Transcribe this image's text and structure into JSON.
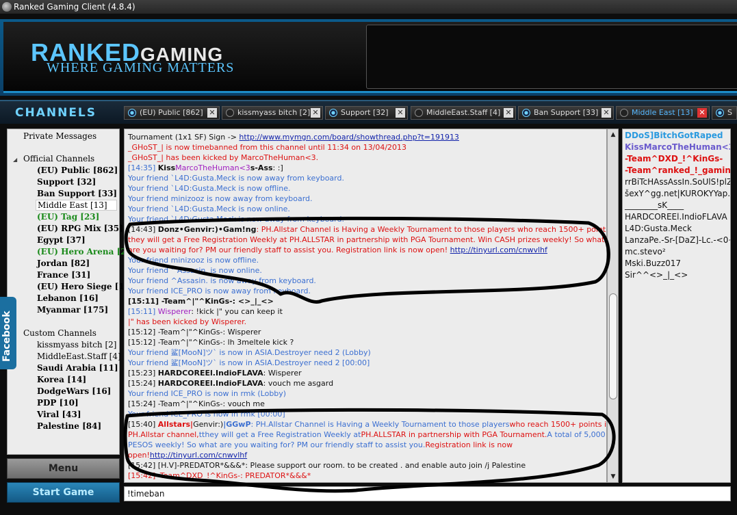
{
  "window": {
    "title": "Ranked Gaming Client (4.8.4)"
  },
  "banner": {
    "logo_main": "RANKED",
    "logo_main2": "GAMING",
    "logo_sub": "WHERE GAMING MATTERS"
  },
  "channels_label": "CHANNELS",
  "tabs": [
    {
      "label": "(EU) Public [862]"
    },
    {
      "label": "kissmyass bitch [2]"
    },
    {
      "label": "Support [32]"
    },
    {
      "label": "MiddleEast.Staff [4]"
    },
    {
      "label": "Ban Support [33]"
    },
    {
      "label": "Middle East [13]"
    },
    {
      "label": "S"
    }
  ],
  "sidebar": {
    "private_messages": "Private Messages",
    "official_heading": "Official Channels",
    "official": [
      "(EU) Public [862]",
      "Support [32]",
      "Ban Support [33]",
      "Middle East [13]",
      "(EU) Tag [23]",
      "(EU) RPG Mix [35]",
      "Egypt [37]",
      "(EU) Hero Arena [22]",
      "Jordan [82]",
      "France [31]",
      "(EU) Hero Siege [16]",
      "Lebanon [16]",
      "Myanmar [175]"
    ],
    "custom_heading": "Custom Channels",
    "custom": [
      "kissmyass bitch [2]",
      "MiddleEast.Staff [4]",
      "Saudi Arabia [11]",
      "Korea [14]",
      "DodgeWars [16]",
      "PDP [10]",
      "Viral [43]",
      "Palestine [84]"
    ]
  },
  "facebook_label": "Facebook",
  "menu_label": "Menu",
  "start_game_label": "Start Game",
  "chat": {
    "l0a": "Tournament   (1x1 SF) Sign ->  ",
    "l0b": "http://www.mymgn.com/board/showthread.php?t=191913",
    "l1": "_GHoST_| is now timebanned from this channel until 11:34 on 13/04/2013",
    "l2": "_GHoST_| has been kicked by MarcoTheHuman<3.",
    "l3a": "[14:35] ",
    "l3b": "Kiss",
    "l3c": "MarcoTheHuman<3",
    "l3d": "s-Ass",
    "l3e": ": :]",
    "l4": "Your friend `L4D:Gusta.Meck is now away from keyboard.",
    "l5": "Your friend `L4D:Gusta.Meck is now offline.",
    "l6": "Your friend minizooz is now away from keyboard.",
    "l7": "Your friend `L4D:Gusta.Meck is now online.",
    "l8": "Your friend `L4D:Gusta.Meck is now away from keyboard.",
    "l9a": "[14:43] ",
    "l9b": "Donz•Genvir:)•Gam!ng",
    "l9c": ": PH.Allstar Channel is Having a Weekly Tournament to those players who reach 1500+ points,",
    "l10": "they will get a Free Registration Weekly at PH.ALLSTAR in partnership with PGA Tournament. Win CASH prizes weekly! So what",
    "l11a": "are you waiting for? PM our friendly staff to assist you. Registration link is now open! ",
    "l11b": "http://tinyurl.com/cnwvlhf",
    "l12": "Your friend minizooz is now offline.",
    "l13": "Your friend ^Assasin. is now online.",
    "l14": "Your friend ^Assasin. is now away from keyboard.",
    "l15": "Your friend ICE_PRO is now away from keyboard.",
    "l16": "[15:11] -Team^|\"^KinGs-: <>_|_<>",
    "l17a": "[15:11] ",
    "l17b": "Wisperer",
    "l17c": ": !kick |\" you can keep it",
    "l18": "|\" has been kicked by Wisperer.",
    "l19": "[15:12] -Team^|\"^KinGs-: Wisperer",
    "l20": "[15:12] -Team^|\"^KinGs-: lh 3meltele kick ?",
    "l21": "Your friend 鲨[MooN]ツ` is now in ASIA.Destroyer need 2 (Lobby)",
    "l22": "Your friend 鲨[MooN]ツ` is now in ASIA.Destroyer need 2 [00:00]",
    "l23a": "[15:23] ",
    "l23b": "HARDCOREEl.IndioFLAVA",
    "l23c": ": Wisperer",
    "l24a": "[15:24] ",
    "l24b": "HARDCOREEl.IndioFLAVA",
    "l24c": ": vouch me asgard",
    "l25": "Your friend ICE_PRO is now in rmk (Lobby)",
    "l26": "[15:24] -Team^|\"^KinGs-: vouch me",
    "l27": "Your friend ICE_PRO is now in rmk [00:00]",
    "l28a": "[15:40] ",
    "l28b": "Allstars|",
    "l28c": "Genvir:)",
    "l28d": "|GGwP",
    "l28e": ": PH.Allstar Channel is Having a Weekly Tournament to those players",
    "l28f": "who reach 1500+ points in",
    "l29a": "PH.Allstar channel,",
    "l29b": "tthey will get a Free Registration Weekly at",
    "l29c": "PH.ALLSTAR in partnership with PGA Tournament.",
    "l29d": "A total of 5,000",
    "l30a": "PESOS weekly! So what are you waiting for? PM our friendly staff to assist you.",
    "l30b": "Registration link is now",
    "l31a": "open!",
    "l31b": "http://tinyurl.com/cnwvlhf",
    "l32": "[15:42] [H.V]-PREDATOR*&&&*: Please support our room. to be created . and enable  auto join     /j Palestine",
    "l33": "[15:42] -Team^DXD_!^KinGs-: PREDATOR*&&&*"
  },
  "users": [
    "DDoS]BitchGotRaped",
    "KissMarcoTheHuman<3...",
    "-Team^DXD_!^KinGs-",
    "-Team^ranked_!_gamin...",
    "rrBiTcHAssAssIn.SoUlS!plZ",
    "šexY^gg.net|KUROKYYap...",
    "________sK____",
    "HARDCOREEl.IndioFLAVA",
    "L4D:Gusta.Meck",
    "LanzaPe.-Sr-[DaZ]-Lc.-<0~",
    "mc.stevo²",
    "Mski.Buzz017",
    "Sir^^<>_|_<>"
  ],
  "input_value": "!timeban",
  "colors": {
    "accent": "#5cc6ff",
    "friend_blue": "#3b6fd1",
    "alert_red": "#d11"
  }
}
